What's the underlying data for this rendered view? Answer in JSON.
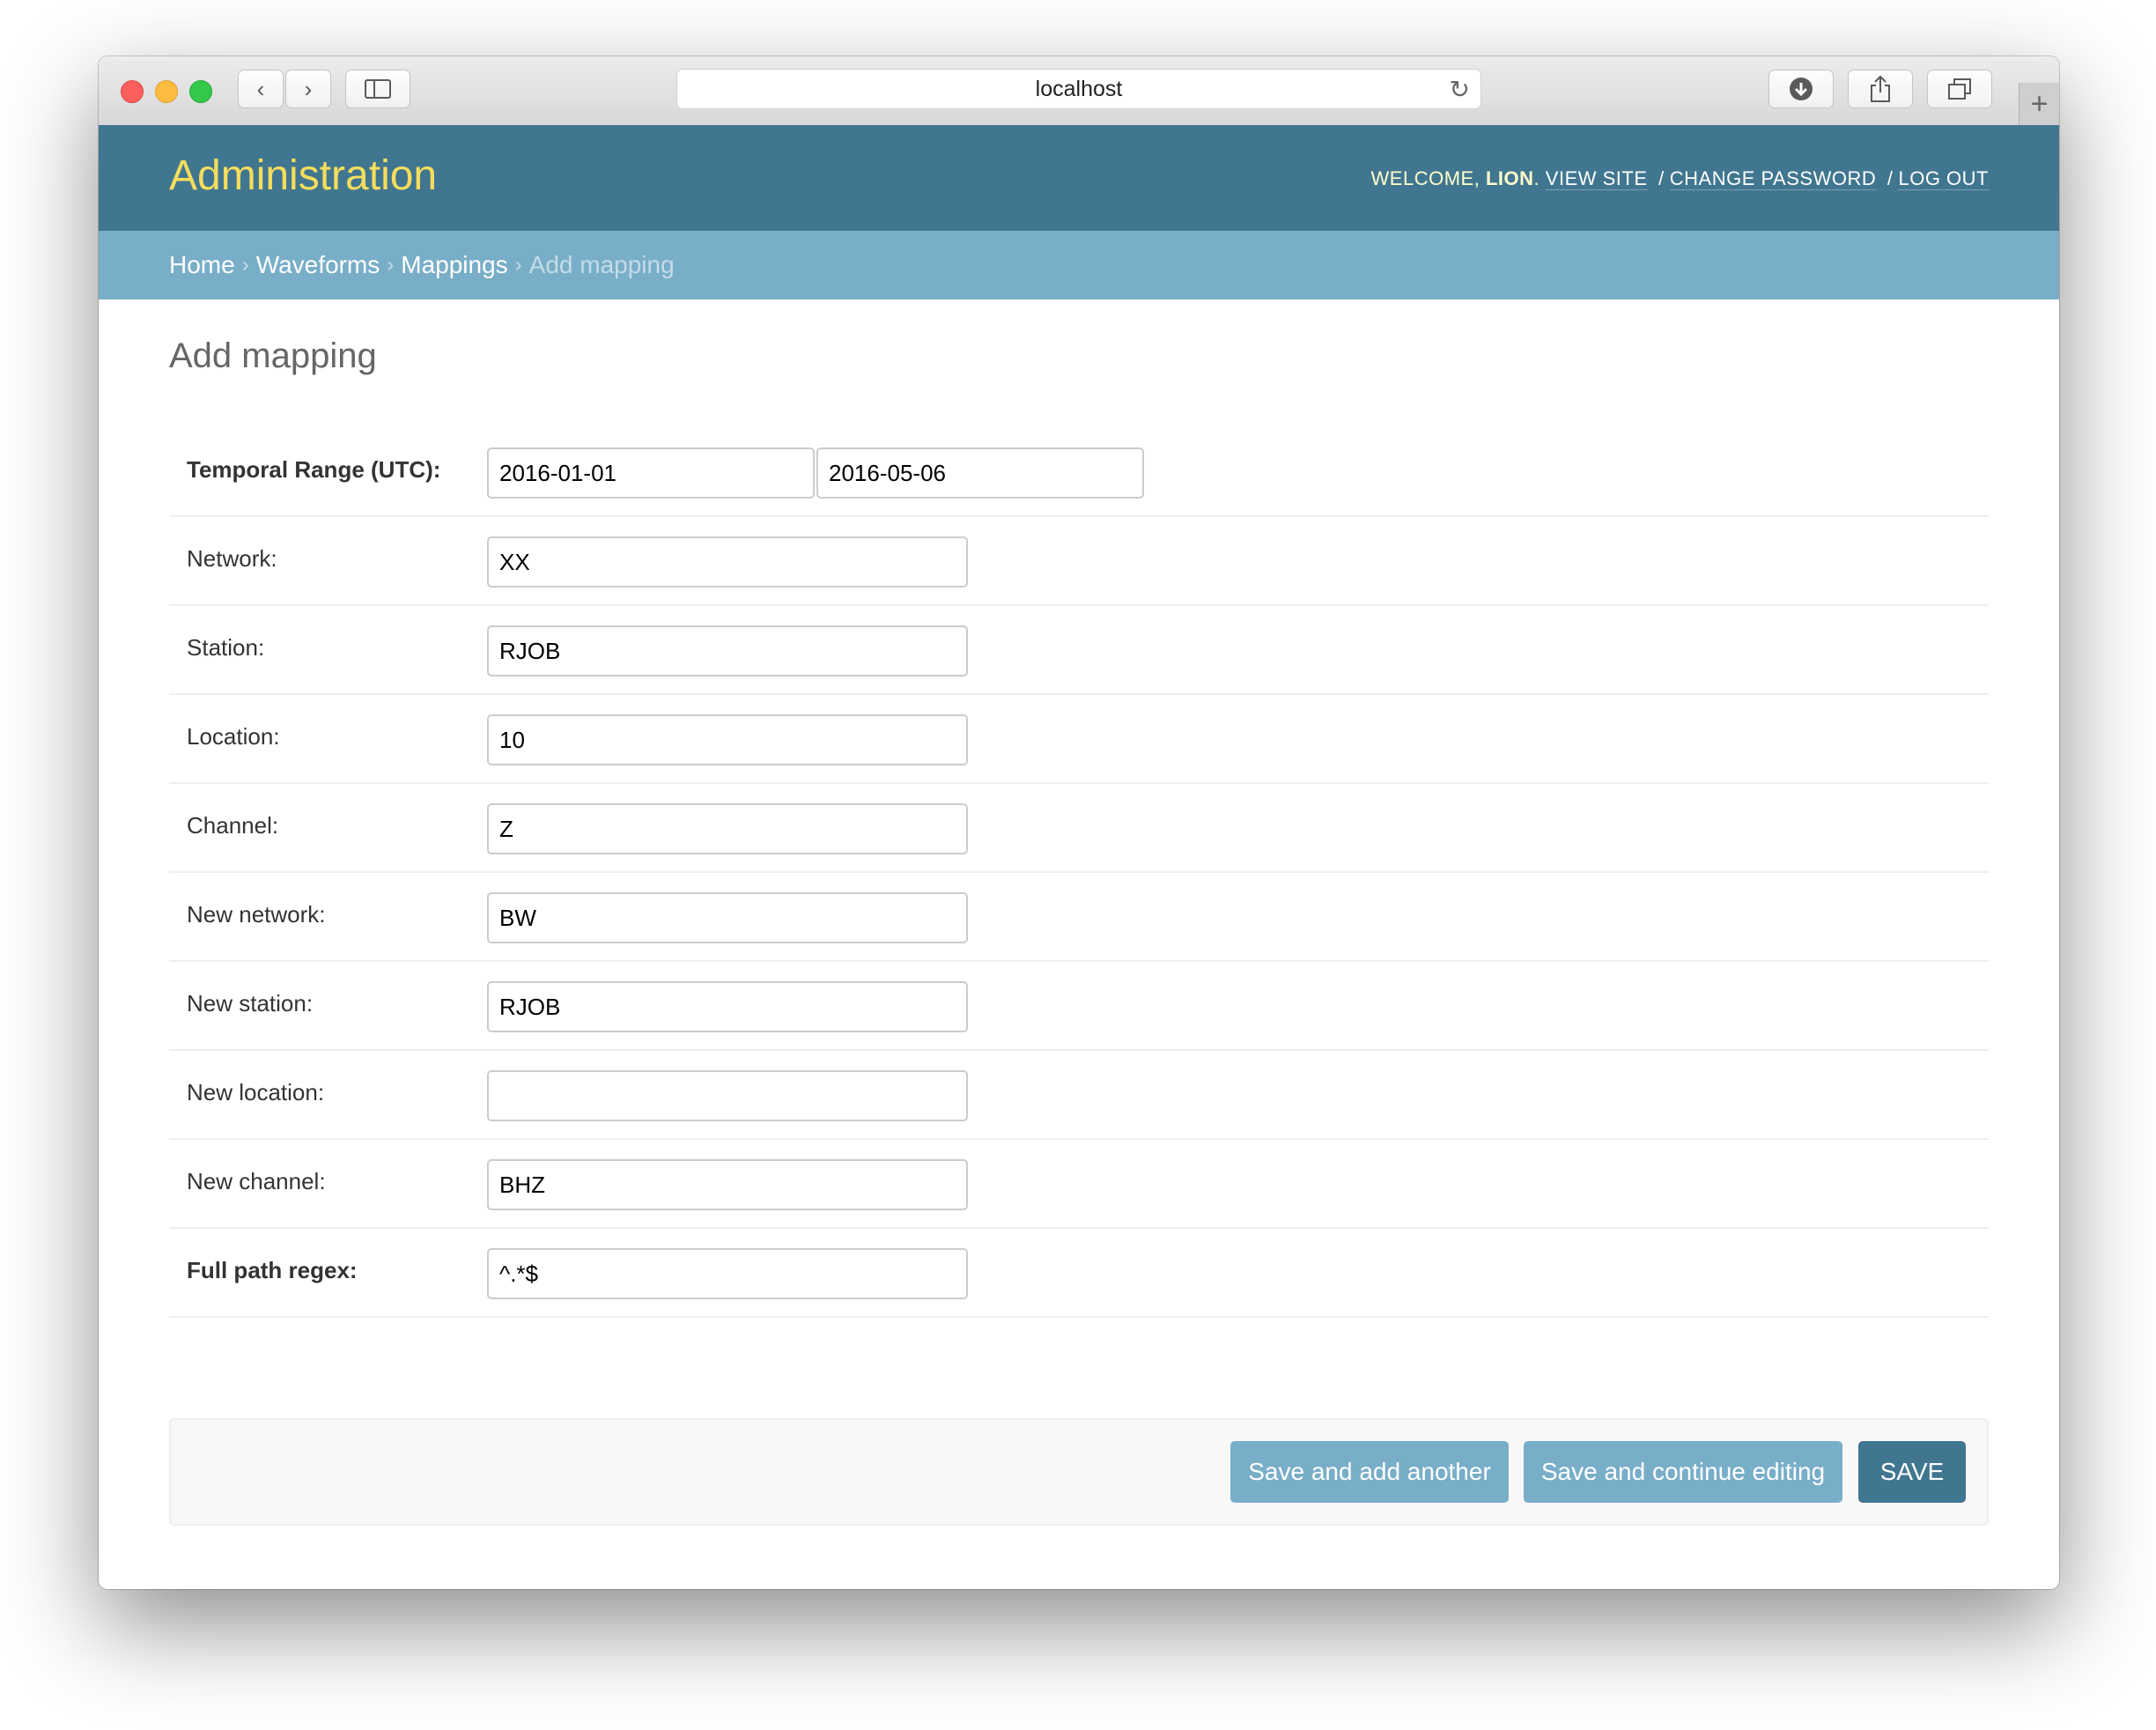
{
  "browser": {
    "address": "localhost",
    "back_icon": "chevron-left-icon",
    "forward_icon": "chevron-right-icon",
    "sidebar_icon": "sidebar-icon",
    "reload_icon": "reload-icon",
    "download_icon": "download-icon",
    "share_icon": "share-icon",
    "tabs_icon": "tabs-icon",
    "newtab_icon": "plus-icon"
  },
  "header": {
    "branding": "Administration",
    "welcome": "WELCOME,",
    "username": "LION",
    "period": ".",
    "view_site": "VIEW SITE",
    "change_password": "CHANGE PASSWORD",
    "log_out": "LOG OUT",
    "separator": "/"
  },
  "breadcrumbs": {
    "items": [
      "Home",
      "Waveforms",
      "Mappings"
    ],
    "current": "Add mapping",
    "separator": "›"
  },
  "page": {
    "title": "Add mapping"
  },
  "form": {
    "temporal_range": {
      "label": "Temporal Range (UTC):",
      "start": "2016-01-01",
      "end": "2016-05-06"
    },
    "fields": [
      {
        "label": "Network:",
        "value": "XX"
      },
      {
        "label": "Station:",
        "value": "RJOB"
      },
      {
        "label": "Location:",
        "value": "10"
      },
      {
        "label": "Channel:",
        "value": "Z"
      },
      {
        "label": "New network:",
        "value": "BW"
      },
      {
        "label": "New station:",
        "value": "RJOB"
      },
      {
        "label": "New location:",
        "value": ""
      },
      {
        "label": "New channel:",
        "value": "BHZ"
      }
    ],
    "regex": {
      "label": "Full path regex:",
      "value": "^.*$"
    }
  },
  "actions": {
    "save_add_another": "Save and add another",
    "save_continue": "Save and continue editing",
    "save": "SAVE"
  },
  "colors": {
    "header_bg": "#417690",
    "branding": "#f5dd5d",
    "breadcrumbs_bg": "#79aec8",
    "button_secondary": "#79aec8",
    "button_primary": "#417690"
  }
}
